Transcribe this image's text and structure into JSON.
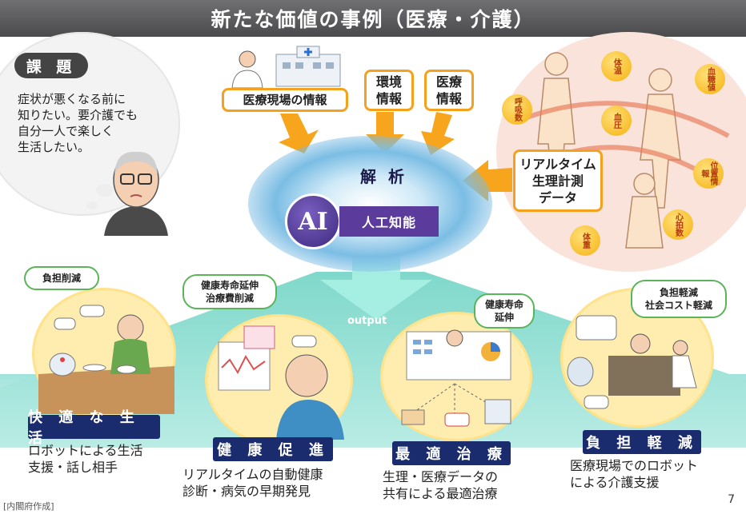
{
  "title": "新たな価値の事例（医療・介護）",
  "issue": {
    "badge": "課 題",
    "lines": [
      "症状が悪くなる前に",
      "知りたい。要介護でも",
      "自分一人で楽しく",
      "生活したい。"
    ]
  },
  "inputs": {
    "med_site": "医療現場の情報",
    "environment": [
      "環境",
      "情報"
    ],
    "medical": [
      "医療",
      "情報"
    ],
    "realtime": [
      "リアルタイム",
      "生理計測",
      "データ"
    ]
  },
  "ai": {
    "analysis": "解 析",
    "ai_text": "AI",
    "label": "人工知能",
    "output": "output"
  },
  "vitals": [
    "体温",
    "呼吸数",
    "血圧",
    "血糖値",
    "位置情報",
    "心拍数",
    "体重"
  ],
  "scenes": [
    {
      "callout": "負担削減",
      "badge": "快 適 な 生 活",
      "desc": [
        "ロボットによる生活",
        "支援・話し相手"
      ]
    },
    {
      "callout": [
        "健康寿命延伸",
        "治療費削減"
      ],
      "badge": "健 康 促 進",
      "desc": [
        "リアルタイムの自動健康",
        "診断・病気の早期発見"
      ]
    },
    {
      "callout": [
        "健康寿命",
        "延伸"
      ],
      "badge": "最 適 治 療",
      "desc": [
        "生理・医療データの",
        "共有による最適治療"
      ]
    },
    {
      "callout": [
        "負担軽減",
        "社会コスト軽減"
      ],
      "badge": "負 担 軽 減",
      "desc": [
        "医療現場でのロボット",
        "による介護支援"
      ]
    }
  ],
  "footer": "[内閣府作成]",
  "page_number": "7",
  "colors": {
    "accent_orange": "#f4a21d",
    "badge_navy": "#1a2b6e",
    "ai_purple": "#5b3c9c",
    "callout_green": "#5bb45a"
  }
}
